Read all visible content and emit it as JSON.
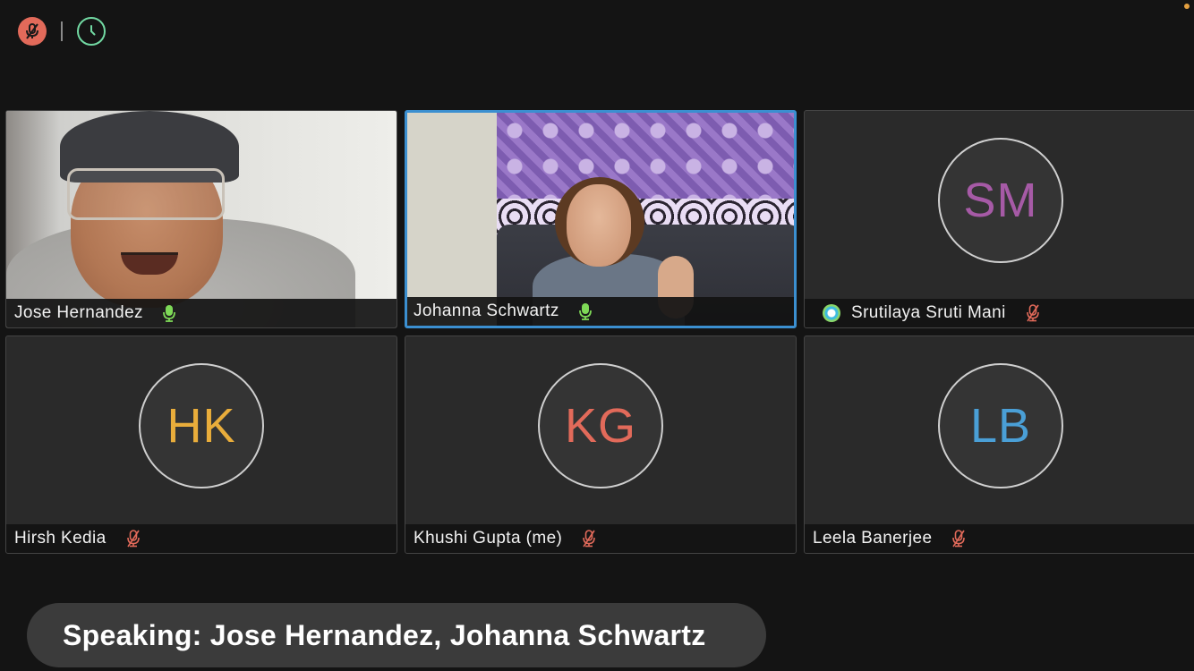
{
  "colors": {
    "background": "#141414",
    "tile_background": "#2a2a2a",
    "active_speaker_border": "#3b8fd0",
    "mute_button": "#e26a5a",
    "timer_icon": "#72d9a3",
    "muted_mic": "#e26a5a",
    "active_mic": "#7ed957",
    "status_dot": "#e3a040"
  },
  "topbar": {
    "mute_icon": "mic-muted-icon",
    "timer_icon": "clock-icon"
  },
  "participants": [
    {
      "name": "Jose Hernandez",
      "video": true,
      "mic": "active",
      "active_speaker": false
    },
    {
      "name": "Johanna Schwartz",
      "video": true,
      "mic": "active",
      "active_speaker": true
    },
    {
      "name": "Srutilaya Sruti Mani",
      "initials": "SM",
      "initials_color": "#a65aa6",
      "video": false,
      "mic": "muted",
      "app_badge": true
    },
    {
      "name": "Hirsh Kedia",
      "initials": "HK",
      "initials_color": "#e9ad3b",
      "video": false,
      "mic": "muted"
    },
    {
      "name": "Khushi Gupta (me)",
      "initials": "KG",
      "initials_color": "#e26a5a",
      "video": false,
      "mic": "muted"
    },
    {
      "name": "Leela Banerjee",
      "initials": "LB",
      "initials_color": "#4a9fd6",
      "video": false,
      "mic": "muted"
    }
  ],
  "speaking_banner": {
    "text": "Speaking: Jose Hernandez, Johanna Schwartz"
  }
}
